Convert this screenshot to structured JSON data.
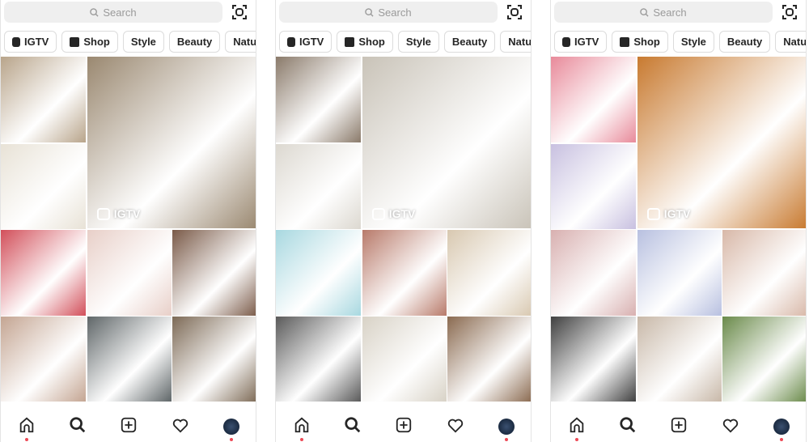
{
  "search": {
    "placeholder": "Search"
  },
  "chips": [
    "IGTV",
    "Shop",
    "Style",
    "Beauty",
    "Nature"
  ],
  "badge_label": "IGTV",
  "nav": [
    "home-icon",
    "search-icon",
    "add-post-icon",
    "heart-icon",
    "profile-avatar"
  ],
  "colors": {
    "accent_dot": "#ed4956",
    "search_bg": "#efefef"
  },
  "panels": [
    {
      "tiles": [
        "#b8a48a",
        "#e8e2d6",
        "#9a8870",
        "#d24f5a",
        "#e8cfc8",
        "#7a5a48",
        "#c4a592",
        "#5f6668",
        "#7d6a56"
      ]
    },
    {
      "tiles": [
        "#8a7a6a",
        "#dcd8d0",
        "#c9c3b8",
        "#a8d8e0",
        "#b87a6a",
        "#d8c8b0",
        "#5a5a5a",
        "#d8d2c6",
        "#8a6a50"
      ]
    },
    {
      "tiles": [
        "#e88a9a",
        "#c8c0e0",
        "#c87a30",
        "#d8b0b0",
        "#b8c0e0",
        "#d8b8a8",
        "#404040",
        "#c8b8a8",
        "#6a8a4a"
      ]
    }
  ]
}
